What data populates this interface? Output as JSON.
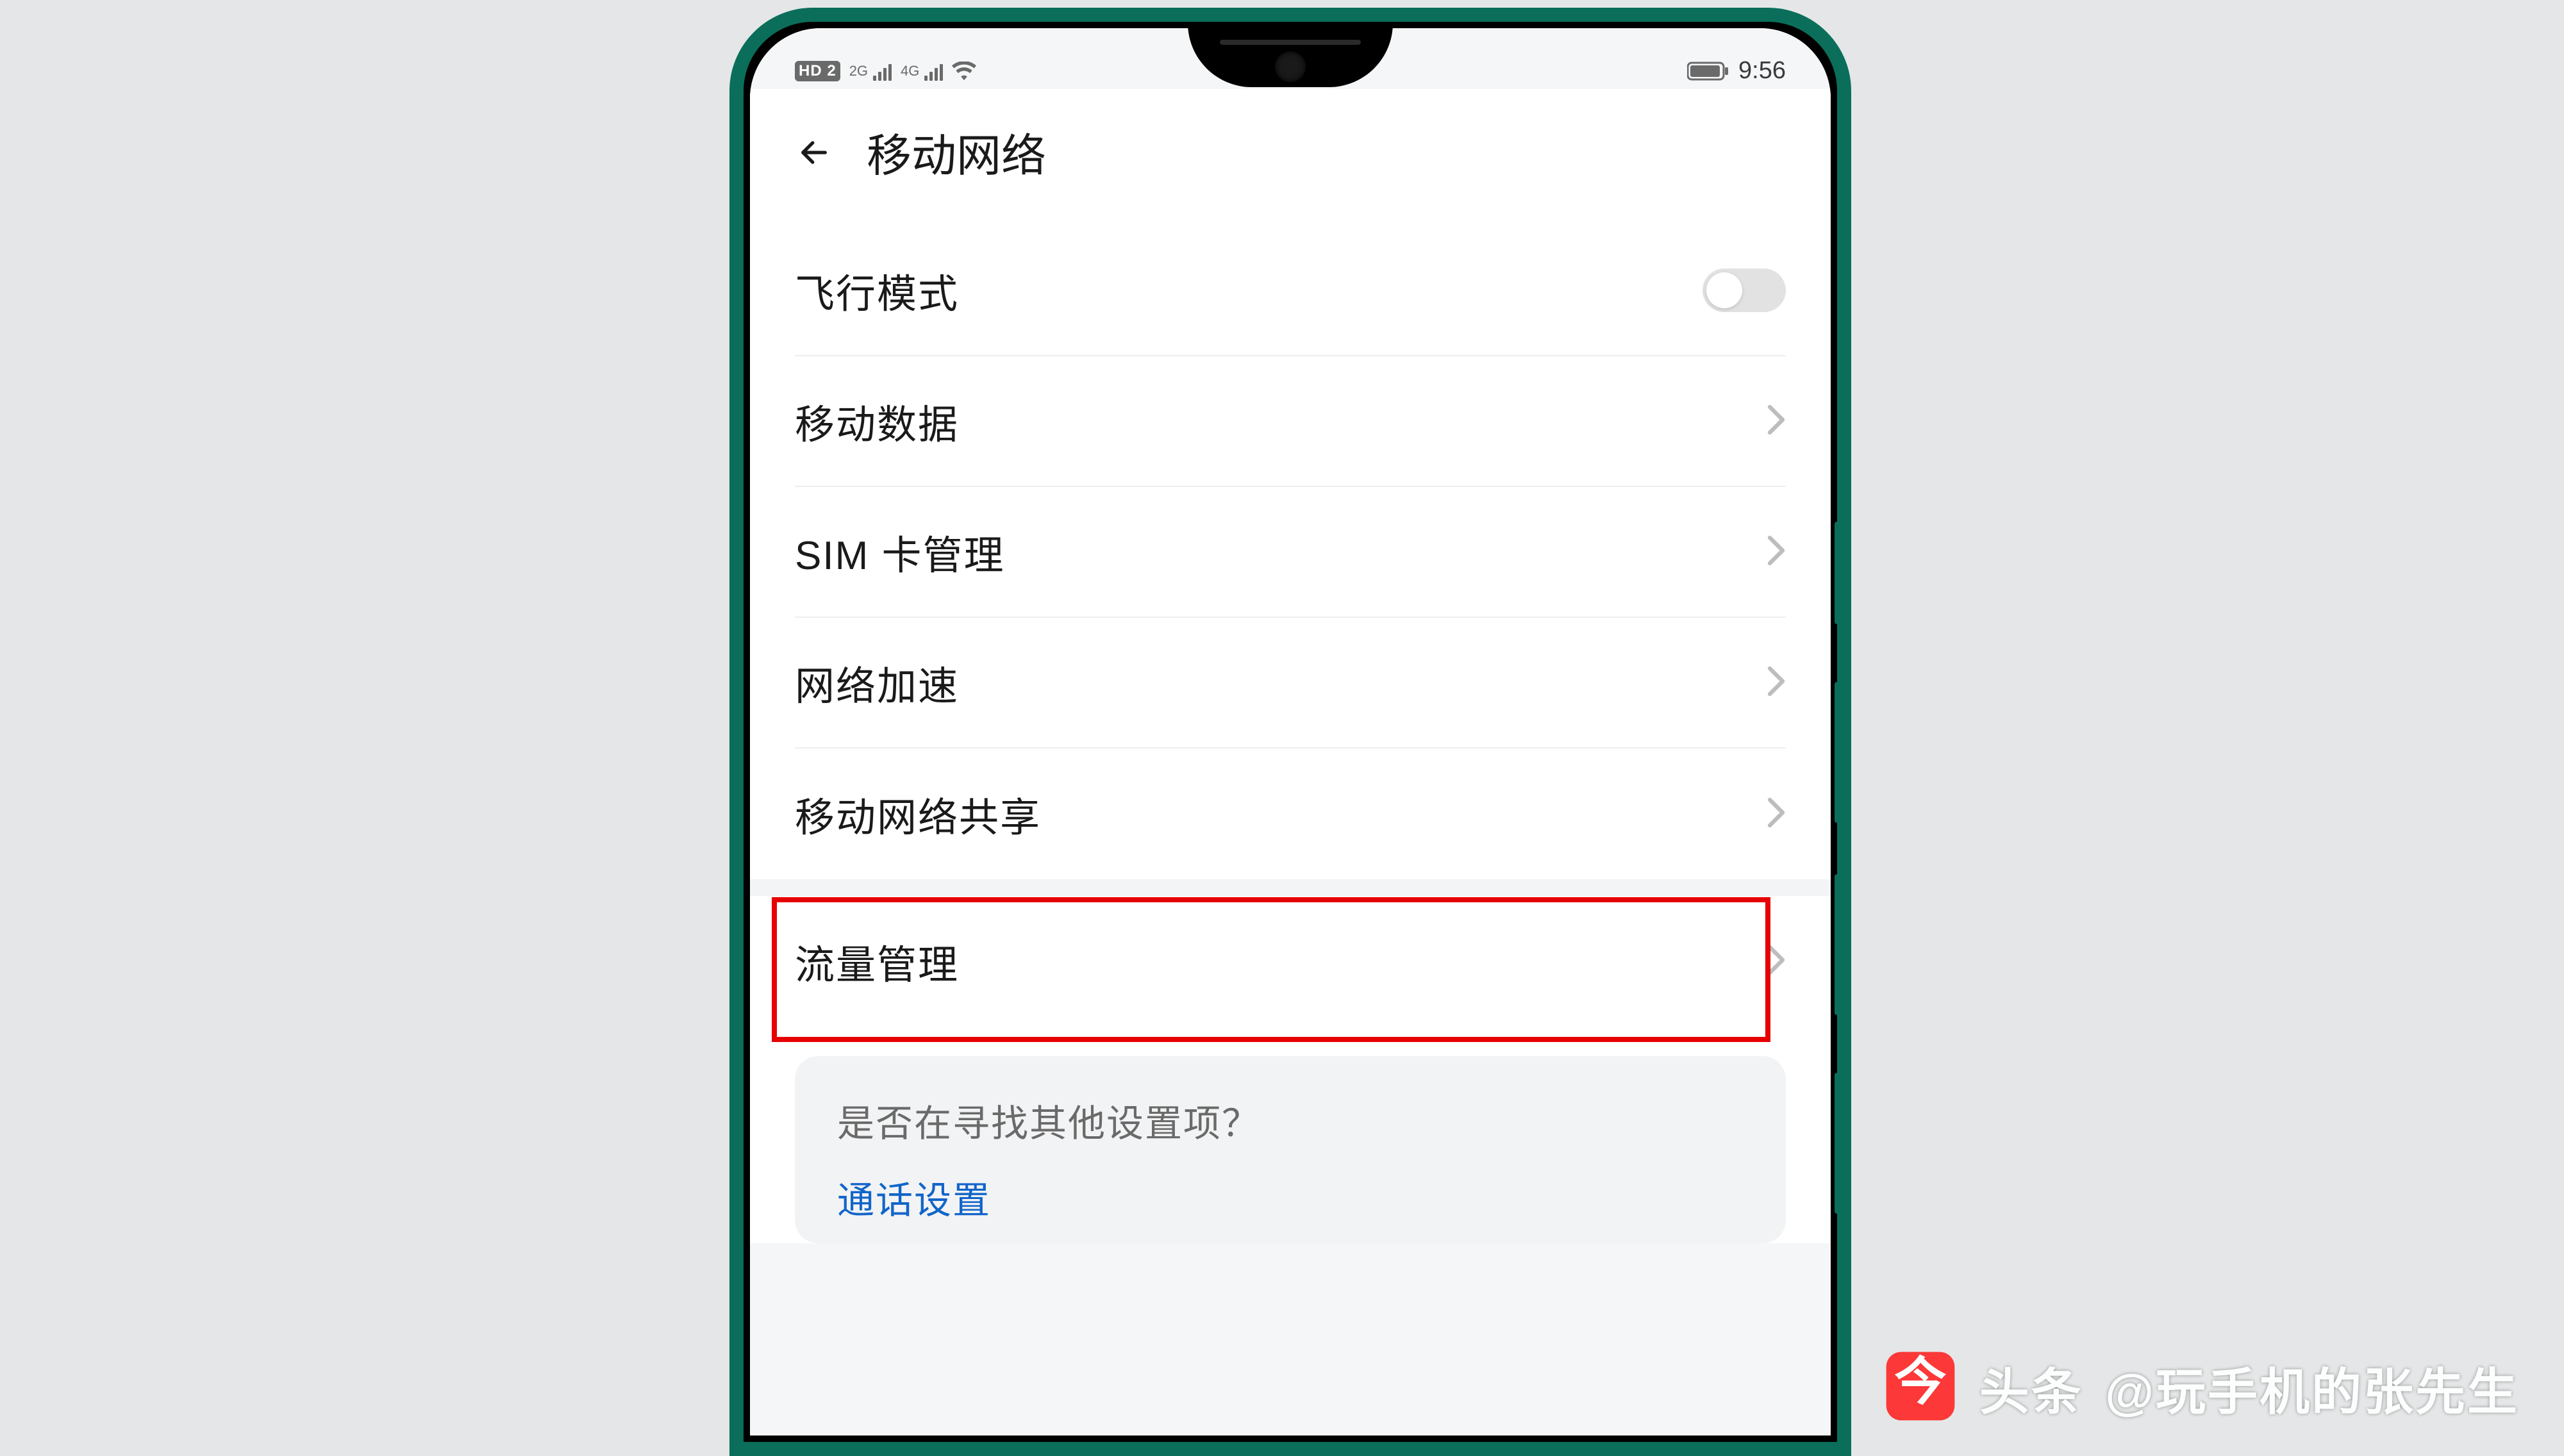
{
  "status": {
    "hd_label": "HD 2",
    "net1_label": "2G",
    "net2_label": "4G",
    "time": "9:56"
  },
  "header": {
    "title": "移动网络"
  },
  "rows": {
    "airplane": {
      "label": "飞行模式"
    },
    "mobile_data": {
      "label": "移动数据"
    },
    "sim": {
      "label": "SIM 卡管理"
    },
    "net_accel": {
      "label": "网络加速"
    },
    "tether": {
      "label": "移动网络共享"
    },
    "data_usage": {
      "label": "流量管理"
    }
  },
  "hint": {
    "question": "是否在寻找其他设置项？",
    "link": "通话设置"
  },
  "watermark": {
    "brand": "头条",
    "handle": "@玩手机的张先生"
  }
}
